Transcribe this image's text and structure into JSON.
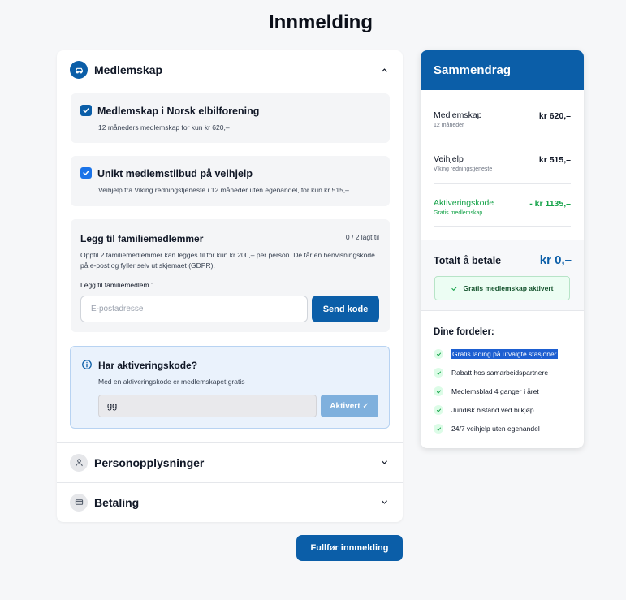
{
  "page": {
    "title": "Innmelding"
  },
  "sections": {
    "membership": {
      "title": "Medlemskap",
      "icon": "car-icon",
      "expanded": true
    },
    "personal": {
      "title": "Personopplysninger",
      "icon": "user-icon",
      "expanded": false
    },
    "payment": {
      "title": "Betaling",
      "icon": "credit-card-icon",
      "expanded": false
    }
  },
  "options": [
    {
      "title": "Medlemskap i Norsk elbilforening",
      "desc": "12 måneders medlemskap for kun kr 620,–",
      "checked": true
    },
    {
      "title": "Unikt medlemstilbud på veihjelp",
      "desc": "Veihjelp fra Viking redningstjeneste i 12 måneder uten egenandel, for kun kr 515,–",
      "checked": true
    }
  ],
  "family": {
    "title": "Legg til familiemedlemmer",
    "count": "0 / 2 lagt til",
    "desc": "Opptil 2 familiemedlemmer kan legges til for kun kr 200,– per person. De får en henvisningskode på e-post og fyller selv ut skjemaet (GDPR).",
    "field_label": "Legg til familiemedlem 1",
    "email_placeholder": "E-postadresse",
    "send_label": "Send kode"
  },
  "activation": {
    "title": "Har aktiveringskode?",
    "desc": "Med en aktiveringskode er medlemskapet gratis",
    "code_value": "gg",
    "button_label": "Aktivert ✓"
  },
  "finish_label": "Fullfør innmelding",
  "summary": {
    "title": "Sammendrag",
    "rows": [
      {
        "label": "Medlemskap",
        "sub": "12 måneder",
        "value": "kr 620,–"
      },
      {
        "label": "Veihjelp",
        "sub": "Viking redningstjeneste",
        "value": "kr 515,–"
      },
      {
        "label": "Aktiveringskode",
        "sub": "Gratis medlemskap",
        "value": "- kr 1135,–"
      }
    ],
    "total_label": "Totalt å betale",
    "total_value": "kr 0,–",
    "free_badge": "Gratis medlemskap aktivert",
    "benefits_title": "Dine fordeler:",
    "benefits": [
      "Gratis lading på utvalgte stasjoner",
      "Rabatt hos samarbeidspartnere",
      "Medlemsblad 4 ganger i året",
      "Juridisk bistand ved bilkjøp",
      "24/7 veihjelp uten egenandel"
    ]
  },
  "colors": {
    "primary": "#0b5ea8",
    "success": "#16a34a",
    "info_bg": "#eaf2fc"
  }
}
